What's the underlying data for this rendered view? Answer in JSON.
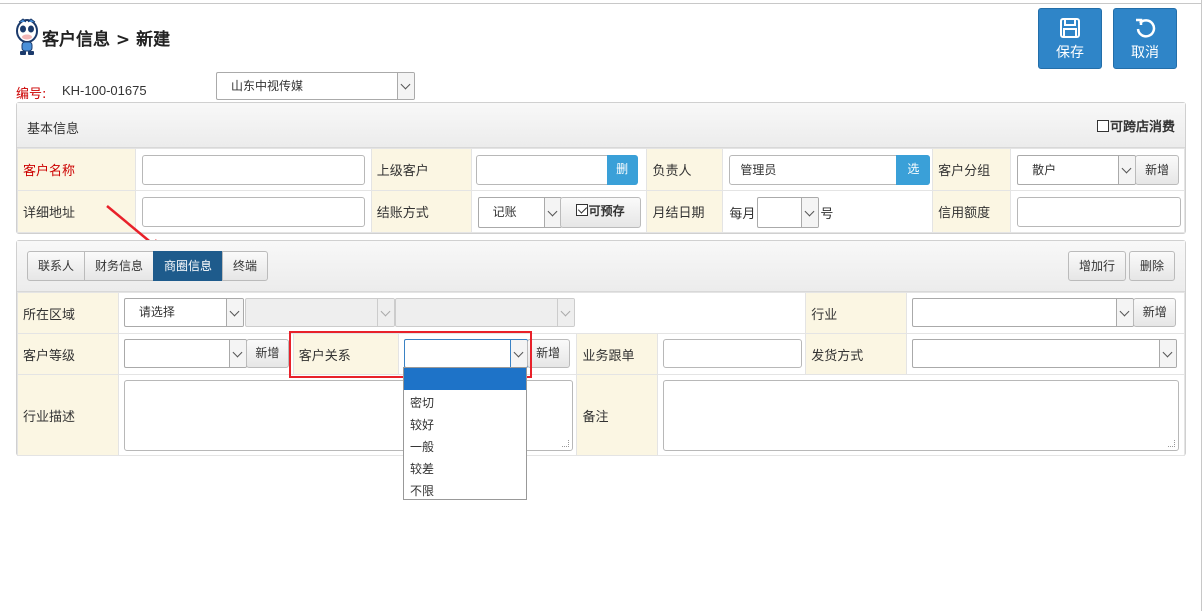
{
  "page": {
    "title": "客户信息 > 新建"
  },
  "toolbar": {
    "save_label": "保存",
    "cancel_label": "取消"
  },
  "header": {
    "code_label": "编号:",
    "code_value": "KH-100-01675",
    "store_select": "山东中视传媒"
  },
  "basic": {
    "title": "基本信息",
    "cross_store_label": "可跨店消费",
    "fields": {
      "customer_name": "客户名称",
      "parent_customer": "上级客户",
      "parent_delete": "删",
      "owner": "负责人",
      "owner_value": "管理员",
      "owner_select": "选",
      "group": "客户分组",
      "group_value": "散户",
      "group_add": "新增",
      "address": "详细地址",
      "settle_method": "结账方式",
      "settle_value": "记账",
      "prepay_label": "可预存",
      "month_date": "月结日期",
      "month_prefix": "每月",
      "month_suffix": "号",
      "credit_limit": "信用额度"
    }
  },
  "tabs": {
    "items": [
      "联系人",
      "财务信息",
      "商圈信息",
      "终端"
    ],
    "active": "商圈信息",
    "add_row": "增加行",
    "delete": "删除"
  },
  "business": {
    "region": "所在区域",
    "region_value": "请选择",
    "industry": "行业",
    "industry_add": "新增",
    "level": "客户等级",
    "level_add": "新增",
    "relation": "客户关系",
    "relation_add": "新增",
    "follow": "业务跟单",
    "ship": "发货方式",
    "industry_desc": "行业描述",
    "remark": "备注"
  },
  "relation_dropdown": {
    "options": [
      "",
      "密切",
      "较好",
      "一般",
      "较差",
      "不限"
    ]
  },
  "colors": {
    "primary": "#2f85c8",
    "tab_active": "#1e5b8c",
    "required": "#cc0000",
    "highlight_box": "#e8212a",
    "label_bg": "#fbf6e3"
  }
}
